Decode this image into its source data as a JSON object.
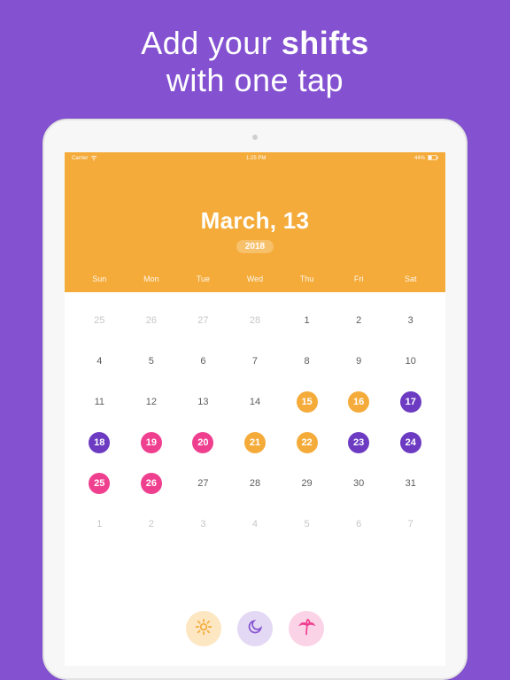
{
  "promo": {
    "pre": "Add your ",
    "bold": "shifts",
    "line2": "with one tap"
  },
  "statusbar": {
    "carrier": "Carrier",
    "time": "1:25 PM",
    "battery": "44%"
  },
  "header": {
    "date": "March, 13",
    "year": "2018"
  },
  "weekdays": [
    "Sun",
    "Mon",
    "Tue",
    "Wed",
    "Thu",
    "Fri",
    "Sat"
  ],
  "days": [
    {
      "n": 25,
      "other": true
    },
    {
      "n": 26,
      "other": true
    },
    {
      "n": 27,
      "other": true
    },
    {
      "n": 28,
      "other": true
    },
    {
      "n": 1
    },
    {
      "n": 2
    },
    {
      "n": 3
    },
    {
      "n": 4
    },
    {
      "n": 5
    },
    {
      "n": 6
    },
    {
      "n": 7
    },
    {
      "n": 8
    },
    {
      "n": 9
    },
    {
      "n": 10
    },
    {
      "n": 11
    },
    {
      "n": 12
    },
    {
      "n": 13
    },
    {
      "n": 14
    },
    {
      "n": 15,
      "shift": "orange"
    },
    {
      "n": 16,
      "shift": "orange"
    },
    {
      "n": 17,
      "shift": "purple"
    },
    {
      "n": 18,
      "shift": "purple"
    },
    {
      "n": 19,
      "shift": "pink"
    },
    {
      "n": 20,
      "shift": "pink"
    },
    {
      "n": 21,
      "shift": "orange"
    },
    {
      "n": 22,
      "shift": "orange"
    },
    {
      "n": 23,
      "shift": "purple"
    },
    {
      "n": 24,
      "shift": "purple"
    },
    {
      "n": 25,
      "shift": "pink"
    },
    {
      "n": 26,
      "shift": "pink"
    },
    {
      "n": 27
    },
    {
      "n": 28
    },
    {
      "n": 29
    },
    {
      "n": 30
    },
    {
      "n": 31
    },
    {
      "n": 1,
      "other": true
    },
    {
      "n": 2,
      "other": true
    },
    {
      "n": 3,
      "other": true
    },
    {
      "n": 4,
      "other": true
    },
    {
      "n": 5,
      "other": true
    },
    {
      "n": 6,
      "other": true
    },
    {
      "n": 7,
      "other": true
    }
  ],
  "shifts": [
    {
      "name": "day",
      "icon": "sun-icon",
      "colorClass": "chip-orange"
    },
    {
      "name": "night",
      "icon": "moon-icon",
      "colorClass": "chip-purple"
    },
    {
      "name": "off",
      "icon": "palm-icon",
      "colorClass": "chip-pink"
    }
  ],
  "colors": {
    "orange": "#f4ab3a",
    "pink": "#ef3f8f",
    "purple": "#6c3bc2",
    "bg": "#8452d1"
  }
}
